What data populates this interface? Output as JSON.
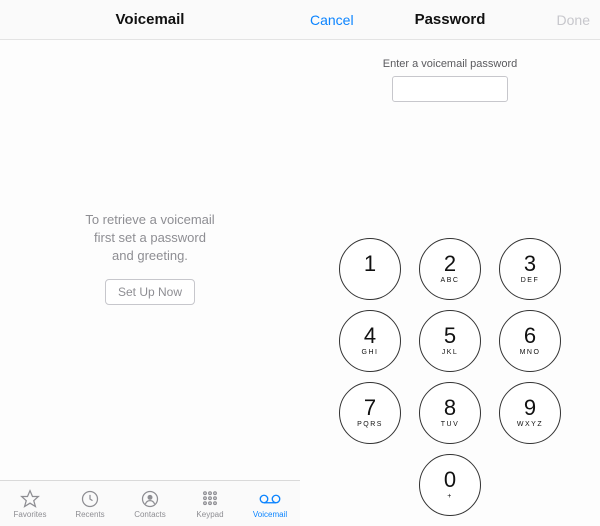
{
  "left": {
    "title": "Voicemail",
    "message": "To retrieve a voicemail\nfirst set a password\nand greeting.",
    "setup_button": "Set Up Now",
    "tabs": [
      {
        "label": "Favorites"
      },
      {
        "label": "Recents"
      },
      {
        "label": "Contacts"
      },
      {
        "label": "Keypad"
      },
      {
        "label": "Voicemail"
      }
    ]
  },
  "right": {
    "title": "Password",
    "cancel": "Cancel",
    "done": "Done",
    "prompt": "Enter a voicemail password",
    "keypad": [
      {
        "num": "1",
        "letters": ""
      },
      {
        "num": "2",
        "letters": "ABC"
      },
      {
        "num": "3",
        "letters": "DEF"
      },
      {
        "num": "4",
        "letters": "GHI"
      },
      {
        "num": "5",
        "letters": "JKL"
      },
      {
        "num": "6",
        "letters": "MNO"
      },
      {
        "num": "7",
        "letters": "PQRS"
      },
      {
        "num": "8",
        "letters": "TUV"
      },
      {
        "num": "9",
        "letters": "WXYZ"
      },
      {
        "num": "0",
        "letters": "+"
      }
    ]
  }
}
